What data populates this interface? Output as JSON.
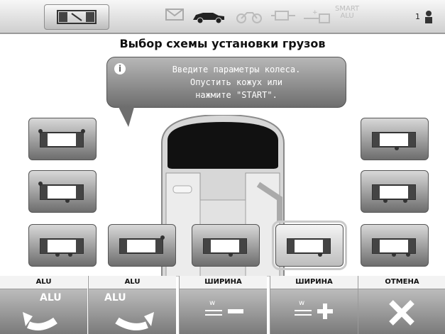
{
  "topbar": {
    "mode_icon": "balancing-machine-icon",
    "icons": [
      "mail-icon",
      "car-icon",
      "motorcycle-icon",
      "battery-icon",
      "weight-icon"
    ],
    "smart_label": "SMART",
    "smart_sub": "ALU",
    "user_number": "1",
    "user_icon": "operator-icon"
  },
  "title": "Выбор схемы установки грузов",
  "bubble": {
    "icon": "info-icon",
    "message": "Введите параметры колеса.\nОпустить кожух или\nнажмите \"START\"."
  },
  "tiles": {
    "left": [
      "alu-scheme-1",
      "alu-scheme-2",
      "alu-scheme-3"
    ],
    "bottom": [
      "alu-scheme-4",
      "alu-scheme-5",
      "alu-scheme-6"
    ],
    "right": [
      "alu-scheme-7",
      "alu-scheme-8",
      "alu-scheme-9"
    ],
    "selected": "alu-scheme-6"
  },
  "buttons": [
    {
      "label": "ALU",
      "face_text": "ALU",
      "icon": "rotate-left-icon"
    },
    {
      "label": "ALU",
      "face_text": "ALU",
      "icon": "rotate-right-icon"
    },
    {
      "label": "ШИРИНА",
      "icon": "width-minus-icon"
    },
    {
      "label": "ШИРИНА",
      "icon": "width-plus-icon"
    },
    {
      "label": "ОТМЕНА",
      "icon": "cancel-icon"
    }
  ],
  "colors": {
    "accent": "#7a7a7a",
    "panel": "#bcbcbc",
    "white": "#ffffff"
  }
}
